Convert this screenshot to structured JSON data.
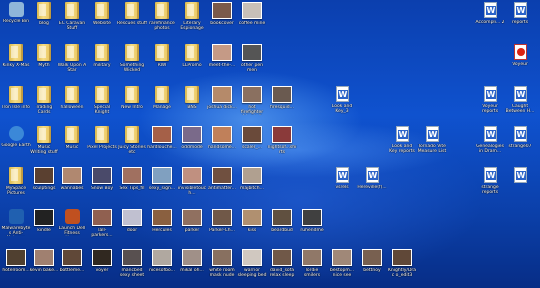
{
  "desktop": {
    "icons": [
      {
        "label": "Recycle Bin",
        "type": "app",
        "color": "#8fb6d9"
      },
      {
        "label": "blog",
        "type": "folder"
      },
      {
        "label": "EC Caravan Stuff",
        "type": "folder"
      },
      {
        "label": "Website",
        "type": "folder"
      },
      {
        "label": "Rescues stuff",
        "type": "folder"
      },
      {
        "label": "rarefinance photos",
        "type": "folder"
      },
      {
        "label": "Literary Espionage",
        "type": "folder"
      },
      {
        "label": "bookcover",
        "type": "photo",
        "color": "#7a5a4a"
      },
      {
        "label": "coffee mine",
        "type": "photo",
        "color": "#c8c0b8"
      },
      {
        "label": "Kinky X-Mas",
        "type": "folder"
      },
      {
        "label": "Myth",
        "type": "folder"
      },
      {
        "label": "Walk Upon A Star",
        "type": "folder"
      },
      {
        "label": "military",
        "type": "folder"
      },
      {
        "label": "Something Wicked",
        "type": "folder"
      },
      {
        "label": "RWI",
        "type": "folder"
      },
      {
        "label": "LLPromo",
        "type": "folder"
      },
      {
        "label": "meet-the-...",
        "type": "photo",
        "color": "#c59a86"
      },
      {
        "label": "other pen men",
        "type": "photo",
        "color": "#555"
      },
      {
        "label": "Iron Isle info",
        "type": "folder"
      },
      {
        "label": "Trading Cards",
        "type": "folder"
      },
      {
        "label": "halloween",
        "type": "folder"
      },
      {
        "label": "Special Knight",
        "type": "folder"
      },
      {
        "label": "New Intro",
        "type": "folder"
      },
      {
        "label": "Manage",
        "type": "folder"
      },
      {
        "label": "BNS",
        "type": "folder"
      },
      {
        "label": "joshua dick...",
        "type": "photo",
        "color": "#b58a6a"
      },
      {
        "label": "hot firefighter friends#",
        "type": "photo",
        "color": "#8a7060"
      },
      {
        "label": "firesquid...",
        "type": "photo",
        "color": "#6a5a50"
      },
      {
        "label": "Google Earth",
        "type": "app",
        "color": "#3b88d8"
      },
      {
        "label": "Music Writing stuff",
        "type": "folder"
      },
      {
        "label": "Music",
        "type": "folder"
      },
      {
        "label": "Pixel Projects",
        "type": "folder"
      },
      {
        "label": "Juicy Stories etc",
        "type": "folder"
      },
      {
        "label": "hardlouche...",
        "type": "photo",
        "color": "#a56048"
      },
      {
        "label": "oddmode",
        "type": "photo",
        "color": "#7a6a8a"
      },
      {
        "label": "handsome...",
        "type": "photo",
        "color": "#c0805a"
      },
      {
        "label": "scaler_...",
        "type": "photo",
        "color": "#6a4a3a"
      },
      {
        "label": "nightsof...shirts",
        "type": "photo",
        "color": "#8a3a3a"
      },
      {
        "label": "MySpace Pictures",
        "type": "folder"
      },
      {
        "label": "sculptings",
        "type": "photo",
        "color": "#5a4030"
      },
      {
        "label": "wannabes",
        "type": "photo",
        "color": "#b08870"
      },
      {
        "label": "Snow Boy",
        "type": "photo",
        "color": "#4a4a6a"
      },
      {
        "label": "Sex Tips_fil",
        "type": "photo",
        "color": "#a07060"
      },
      {
        "label": "sexy_sign...",
        "type": "photo",
        "color": "#80a0c0"
      },
      {
        "label": "invisibletouch...",
        "type": "photo",
        "color": "#c09080"
      },
      {
        "label": "antimatter...",
        "type": "photo",
        "color": "#705040"
      },
      {
        "label": "majbitch...",
        "type": "photo",
        "color": "#b0a090"
      },
      {
        "label": "Malwarebytes Anti-Malware",
        "type": "app",
        "color": "#2060b0"
      },
      {
        "label": "kindle",
        "type": "photo",
        "color": "#222"
      },
      {
        "label": "Launch Dell Fitness Home",
        "type": "app",
        "color": "#c05020"
      },
      {
        "label": "Tall-parkers...",
        "type": "photo",
        "color": "#906050"
      },
      {
        "label": "door",
        "type": "photo",
        "color": "#c0c0d0"
      },
      {
        "label": "Hercules",
        "type": "photo",
        "color": "#8a6040"
      },
      {
        "label": "parker",
        "type": "photo",
        "color": "#907060"
      },
      {
        "label": "Parker-Ch...",
        "type": "photo",
        "color": "#705848"
      },
      {
        "label": "kiss",
        "type": "photo",
        "color": "#b09070"
      },
      {
        "label": "beardbud",
        "type": "photo",
        "color": "#605040"
      },
      {
        "label": "ruhendme",
        "type": "photo",
        "color": "#404040"
      },
      {
        "label": "Bryan Davi...",
        "type": "photo",
        "color": "#504030"
      },
      {
        "label": "hotelroom...",
        "type": "photo",
        "color": "#a08070"
      },
      {
        "label": "kevin bake...",
        "type": "photo",
        "color": "#604838"
      },
      {
        "label": "bottleme...",
        "type": "photo",
        "color": "#302820"
      },
      {
        "label": "voyer",
        "type": "photo",
        "color": "#585050"
      },
      {
        "label": "mancbed sexy sheet",
        "type": "photo",
        "color": "#b0a8a0"
      },
      {
        "label": "nicesofbo...",
        "type": "photo",
        "color": "#a09088"
      },
      {
        "label": "mikal oh...",
        "type": "photo",
        "color": "#887060"
      },
      {
        "label": "white room mask nude",
        "type": "photo",
        "color": "#d0c8c0"
      },
      {
        "label": "warrior sleeping bed",
        "type": "photo",
        "color": "#705848"
      },
      {
        "label": "david_sofa relax sleep",
        "type": "photo",
        "color": "#907868"
      },
      {
        "label": "lordie smilers",
        "type": "photo",
        "color": "#a08878"
      },
      {
        "label": "bestopm... nice see",
        "type": "photo",
        "color": "#786050"
      },
      {
        "label": "bettnoy",
        "type": "photo",
        "color": "#604838"
      },
      {
        "label": "Knightly/Drac o_edit3",
        "type": "doc"
      },
      {
        "label": "Look and Key_3",
        "type": "doc"
      },
      {
        "label": "Look and Key reports",
        "type": "doc"
      },
      {
        "label": "Tornado Vite Measure List",
        "type": "doc"
      },
      {
        "label": "vsrels",
        "type": "doc"
      },
      {
        "label": "Hereville(f)...",
        "type": "doc"
      },
      {
        "label": "Accompli... 2",
        "type": "doc"
      },
      {
        "label": "reports",
        "type": "pdf"
      },
      {
        "label": "Voyeur",
        "type": "doc"
      },
      {
        "label": "Voyeur reports",
        "type": "doc"
      },
      {
        "label": "Caught Between H...",
        "type": "doc"
      },
      {
        "label": "Genealogies in Dram...",
        "type": "doc"
      },
      {
        "label": "strange07",
        "type": "doc"
      },
      {
        "label": "strange reports",
        "type": "doc"
      }
    ]
  }
}
